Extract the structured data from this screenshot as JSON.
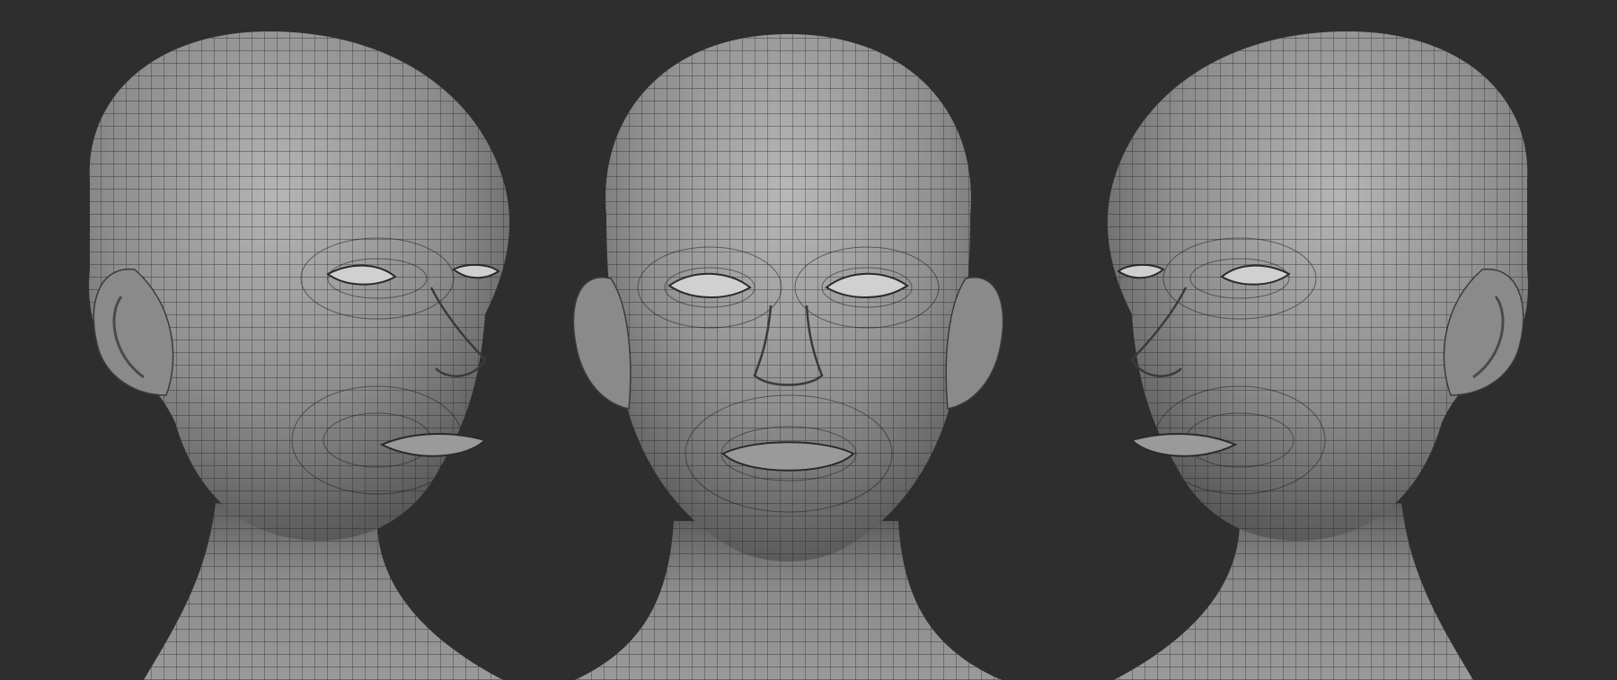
{
  "scene": {
    "background_color": "#2e2e2e",
    "mesh_color": "#8a8a8a",
    "wire_color": "#1f1f1f",
    "views": [
      {
        "name": "three-quarter-right"
      },
      {
        "name": "front"
      },
      {
        "name": "three-quarter-left"
      }
    ]
  }
}
